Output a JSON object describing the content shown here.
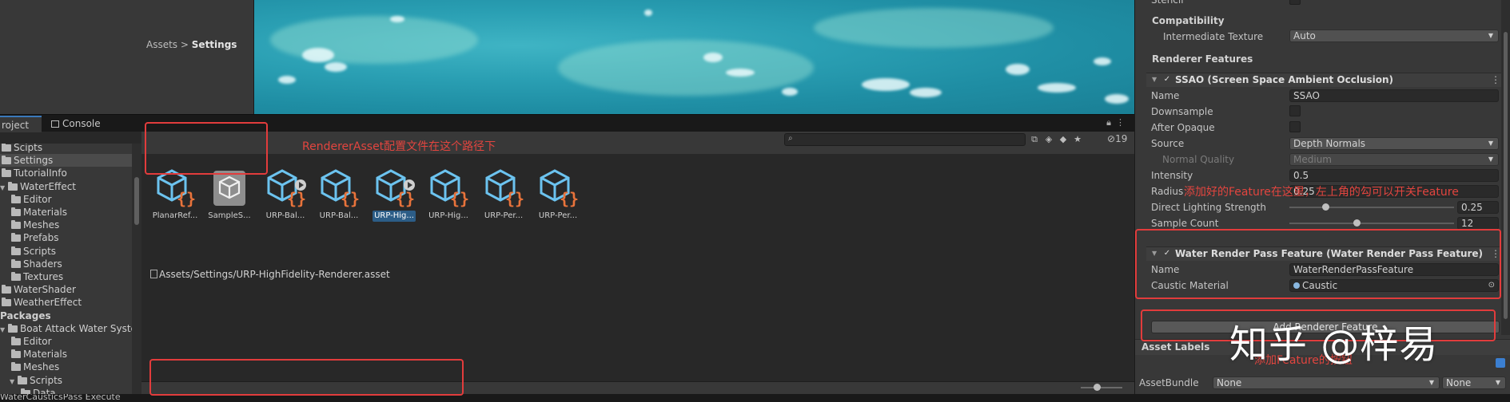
{
  "project_tabs": [
    {
      "label": "roject"
    },
    {
      "label": "Console",
      "icon": "console-icon"
    }
  ],
  "tree": [
    {
      "label": "Scipts",
      "indent": 0
    },
    {
      "label": "Settings",
      "indent": 0,
      "selected": true
    },
    {
      "label": "TutorialInfo",
      "indent": 0
    },
    {
      "label": "WaterEffect",
      "indent": 0,
      "expanded": true
    },
    {
      "label": "Editor",
      "indent": 1
    },
    {
      "label": "Materials",
      "indent": 1
    },
    {
      "label": "Meshes",
      "indent": 1
    },
    {
      "label": "Prefabs",
      "indent": 1
    },
    {
      "label": "Scripts",
      "indent": 1
    },
    {
      "label": "Shaders",
      "indent": 1
    },
    {
      "label": "Textures",
      "indent": 1
    },
    {
      "label": "WaterShader",
      "indent": 0
    },
    {
      "label": "WeatherEffect",
      "indent": 0
    },
    {
      "label": "Packages",
      "indent": 0,
      "header": true
    },
    {
      "label": "Boat Attack Water System",
      "indent": 0,
      "expanded": true
    },
    {
      "label": "Editor",
      "indent": 1
    },
    {
      "label": "Materials",
      "indent": 1
    },
    {
      "label": "Meshes",
      "indent": 1
    },
    {
      "label": "Scripts",
      "indent": 1,
      "expanded": true
    },
    {
      "label": "Data",
      "indent": 2
    }
  ],
  "breadcrumb": {
    "root": "Assets",
    "separator": ">",
    "current": "Settings"
  },
  "hidden_count": "19",
  "assets": [
    {
      "label": "PlanarRef...",
      "icon": "scriptable-object-icon",
      "play": false
    },
    {
      "label": "SampleS...",
      "icon": "unity-cube-icon",
      "play": false
    },
    {
      "label": "URP-Bal...",
      "icon": "scriptable-object-icon",
      "play": true
    },
    {
      "label": "URP-Bal...",
      "icon": "scriptable-object-icon",
      "play": false
    },
    {
      "label": "URP-Hig...",
      "icon": "scriptable-object-icon",
      "play": true,
      "selected": true
    },
    {
      "label": "URP-Hig...",
      "icon": "scriptable-object-icon",
      "play": false
    },
    {
      "label": "URP-Per...",
      "icon": "scriptable-object-icon",
      "play": false
    },
    {
      "label": "URP-Per...",
      "icon": "scriptable-object-icon",
      "play": false
    }
  ],
  "asset_path": "Assets/Settings/URP-HighFidelity-Renderer.asset",
  "inspector": {
    "top_cut_label": "Stencil",
    "compatibility_header": "Compatibility",
    "intermediate_texture_label": "Intermediate Texture",
    "intermediate_texture_value": "Auto",
    "renderer_features_header": "Renderer Features",
    "ssao": {
      "title": "SSAO (Screen Space Ambient Occlusion)",
      "name_label": "Name",
      "name_value": "SSAO",
      "downsample_label": "Downsample",
      "after_opaque_label": "After Opaque",
      "source_label": "Source",
      "source_value": "Depth Normals",
      "normal_quality_label": "Normal Quality",
      "normal_quality_value": "Medium",
      "intensity_label": "Intensity",
      "intensity_value": "0.5",
      "radius_label": "Radius",
      "radius_value": "0.25",
      "direct_lighting_label": "Direct Lighting Strength",
      "direct_lighting_value": "0.25",
      "direct_lighting_fraction": 0.22,
      "sample_count_label": "Sample Count",
      "sample_count_value": "12",
      "sample_count_fraction": 0.41
    },
    "water": {
      "title": "Water Render Pass Feature (Water Render Pass Feature)",
      "name_label": "Name",
      "name_value": "WaterRenderPassFeature",
      "caustic_label": "Caustic Material",
      "caustic_value": "Caustic"
    },
    "add_feature_label": "Add Renderer Feature",
    "asset_labels_title": "Asset Labels",
    "assetbundle_label": "AssetBundle",
    "assetbundle_value": "None",
    "assetbundle_variant": "None"
  },
  "annotations": {
    "path_note": "RendererAsset配置文件在这个路径下",
    "feature_note": "添加好的Feature在这里，左上角的勾可以开关Feature",
    "button_note": "添加Feature的按钮"
  },
  "watermark": "知乎 @梓易",
  "bottom_text": "WaterCausticsPass Execute",
  "colors": {
    "annotation": "#e23c3c",
    "selection": "#2c5d87",
    "accent": "#3a79bb"
  }
}
